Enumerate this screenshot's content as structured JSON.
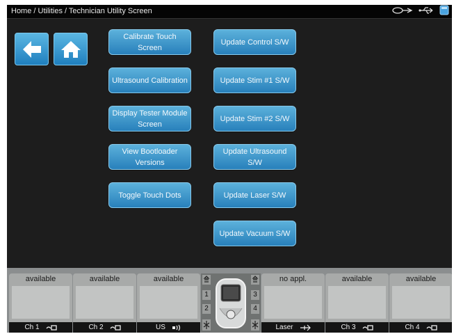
{
  "breadcrumb": "Home / Utilities / Technician Utility Screen",
  "nav": {
    "back_icon": "back-arrow-icon",
    "home_icon": "home-icon"
  },
  "left_buttons": [
    "Calibrate Touch Screen",
    "Ultrasound Calibration",
    "Display Tester Module Screen",
    "View Bootloader Versions",
    "Toggle Touch Dots"
  ],
  "right_buttons": [
    "Update Control S/W",
    "Update Stim #1 S/W",
    "Update Stim #2 S/W",
    "Update Ultrasound S/W",
    "Update Laser S/W",
    "Update Vacuum S/W"
  ],
  "channels": [
    {
      "status": "available",
      "label": "Ch 1",
      "icon": "stim-connector-icon"
    },
    {
      "status": "available",
      "label": "Ch 2",
      "icon": "stim-connector-icon"
    },
    {
      "status": "available",
      "label": "US",
      "icon": "ultrasound-icon"
    },
    {
      "status": "no appl.",
      "label": "Laser",
      "icon": "laser-icon"
    },
    {
      "status": "available",
      "label": "Ch 3",
      "icon": "stim-connector-icon"
    },
    {
      "status": "available",
      "label": "Ch 4",
      "icon": "stim-connector-icon"
    }
  ],
  "center_unit": {
    "left_numbers": [
      "1",
      "2"
    ],
    "right_numbers": [
      "3",
      "4"
    ]
  },
  "status_icons": [
    "probe-icon",
    "usb-icon",
    "storage-icon"
  ],
  "colors": {
    "button": "#3a90c8",
    "background": "#1d1d1d",
    "panel": "#a8aaa9"
  }
}
